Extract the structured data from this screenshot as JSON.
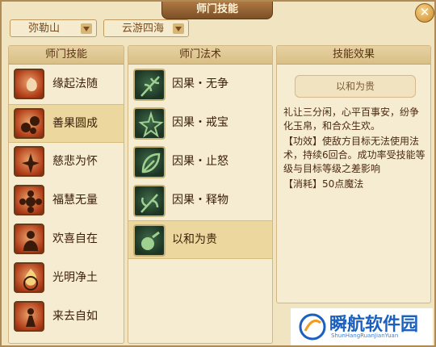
{
  "window": {
    "title": "师门技能",
    "close_label": "✕"
  },
  "filters": {
    "sect_selected": "弥勒山",
    "school_selected": "云游四海"
  },
  "columns": {
    "skills_header": "师门技能",
    "methods_header": "师门法术",
    "effect_header": "技能效果"
  },
  "skills": [
    {
      "label": "缘起法随",
      "icon": "incense-icon"
    },
    {
      "label": "善果圆成",
      "icon": "fruit-icon",
      "selected": true
    },
    {
      "label": "慈悲为怀",
      "icon": "lotus-icon"
    },
    {
      "label": "福慧无量",
      "icon": "flower-icon"
    },
    {
      "label": "欢喜自在",
      "icon": "buddha-icon"
    },
    {
      "label": "光明净土",
      "icon": "flame-icon"
    },
    {
      "label": "来去自如",
      "icon": "figure-icon"
    }
  ],
  "methods": [
    {
      "label": "因果・无争",
      "icon": "branch-icon"
    },
    {
      "label": "因果・戒宝",
      "icon": "star-icon"
    },
    {
      "label": "因果・止怒",
      "icon": "leaf-icon"
    },
    {
      "label": "因果・释物",
      "icon": "twig-icon"
    },
    {
      "label": "以和为贵",
      "icon": "orb-icon",
      "selected": true
    }
  ],
  "effect": {
    "title": "以和为贵",
    "lines": [
      "礼让三分闲，心平百事安，纷争化玉帛，和合众生欢。",
      "【功效】使敌方目标无法使用法术，持续6回合。成功率受技能等级与目标等级之差影响",
      "【消耗】50点魔法"
    ]
  },
  "watermark": {
    "text": "瞬航软件园",
    "sub": "ShunHangRuanJianYuan"
  },
  "colors": {
    "frame": "#b08a55",
    "panel": "#f6ecd2",
    "selected": "#ecd89e",
    "accent_text": "#7a4a1e"
  }
}
